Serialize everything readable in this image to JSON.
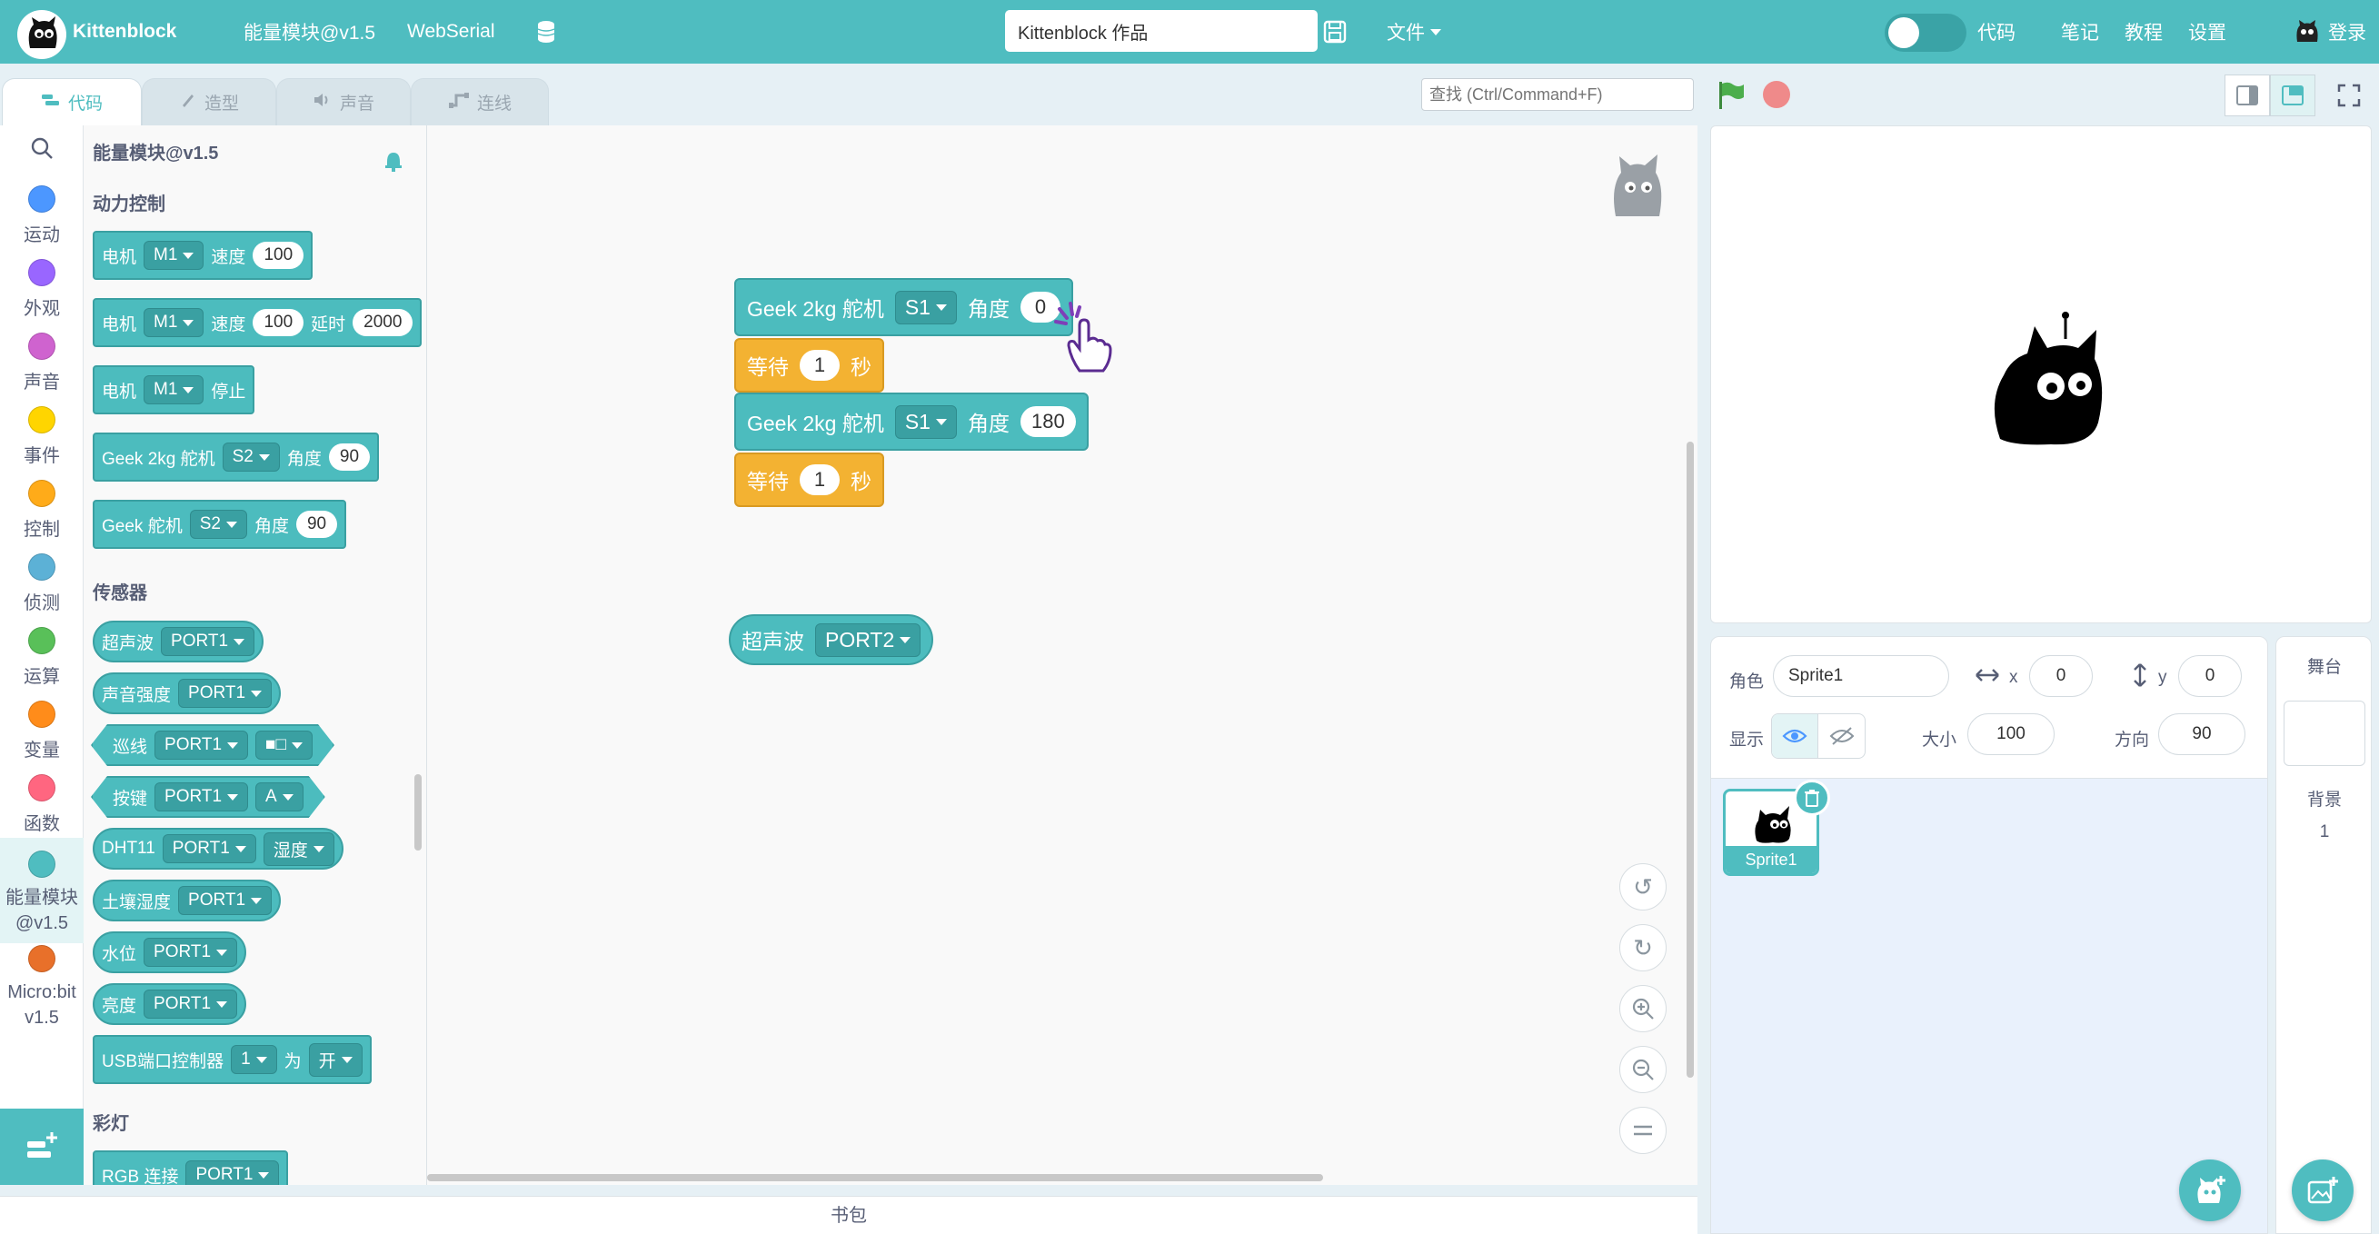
{
  "topbar": {
    "app_name": "Kittenblock",
    "device": "能量模块@v1.5",
    "connection": "WebSerial",
    "project_title": "Kittenblock 作品",
    "file_menu": "文件",
    "code_toggle_label": "代码",
    "notes": "笔记",
    "tutorial": "教程",
    "settings": "设置",
    "login": "登录"
  },
  "tabs": [
    {
      "label": "代码",
      "icon": "code-icon"
    },
    {
      "label": "造型",
      "icon": "brush-icon"
    },
    {
      "label": "声音",
      "icon": "speaker-icon"
    },
    {
      "label": "连线",
      "icon": "wire-icon"
    }
  ],
  "search": {
    "placeholder": "查找 (Ctrl/Command+F)"
  },
  "categories": [
    {
      "label": "运动",
      "color": "#4c97ff"
    },
    {
      "label": "外观",
      "color": "#9966ff"
    },
    {
      "label": "声音",
      "color": "#cf63cf"
    },
    {
      "label": "事件",
      "color": "#ffd500"
    },
    {
      "label": "控制",
      "color": "#ffab19"
    },
    {
      "label": "侦测",
      "color": "#5cb1d6"
    },
    {
      "label": "运算",
      "color": "#59c059"
    },
    {
      "label": "变量",
      "color": "#ff8c1a"
    },
    {
      "label": "函数",
      "color": "#ff6680"
    },
    {
      "label": "能量模块\n@v1.5",
      "color": "#4fbdc0"
    },
    {
      "label": "Micro:bit\nv1.5",
      "color": "#e8702a"
    }
  ],
  "palette": {
    "title": "能量模块@v1.5",
    "section_motor": "动力控制",
    "section_sensor": "传感器",
    "section_light": "彩灯",
    "motor": "电机",
    "speed": "速度",
    "delay": "延时",
    "stop": "停止",
    "geek2kg": "Geek 2kg 舵机",
    "geek": "Geek 舵机",
    "angle": "角度",
    "m1": "M1",
    "s2": "S2",
    "v100": "100",
    "v2000": "2000",
    "v90": "90",
    "ultrasonic": "超声波",
    "sound": "声音强度",
    "line": "巡线",
    "key": "按键",
    "dht": "DHT11",
    "soil": "土壤湿度",
    "water": "水位",
    "light": "亮度",
    "usb": "USB端口控制器",
    "port1": "PORT1",
    "square": "■□",
    "a": "A",
    "humidity": "湿度",
    "one": "1",
    "for": "为",
    "on": "开",
    "rgb": "RGB 连接"
  },
  "script": {
    "servo_label": "Geek 2kg 舵机",
    "s1": "S1",
    "angle": "角度",
    "angle1": "0",
    "angle2": "180",
    "wait": "等待",
    "wait_val": "1",
    "seconds": "秒",
    "ultrasonic": "超声波",
    "port2": "PORT2"
  },
  "backpack": "书包",
  "sprite": {
    "label": "角色",
    "name": "Sprite1",
    "x_label": "x",
    "x": "0",
    "y_label": "y",
    "y": "0",
    "show_label": "显示",
    "size_label": "大小",
    "size": "100",
    "direction_label": "方向",
    "direction": "90",
    "tile_name": "Sprite1"
  },
  "stage_panel": {
    "title": "舞台",
    "backdrop_label": "背景",
    "backdrop_count": "1"
  },
  "colors": {
    "brand": "#4fbdc0",
    "control_yellow": "#f3b232"
  }
}
